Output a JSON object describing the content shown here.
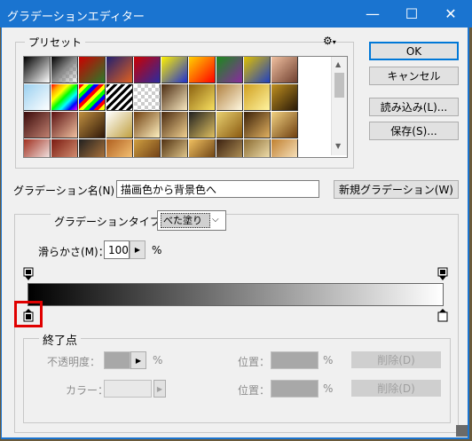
{
  "window": {
    "title": "グラデーションエディター",
    "minimize_glyph": "—",
    "maximize_glyph": "☐",
    "close_glyph": "✕"
  },
  "preset": {
    "label": "プリセット",
    "gear_glyph": "⚙"
  },
  "buttons": {
    "ok": "OK",
    "cancel": "キャンセル",
    "load": "読み込み(L)...",
    "save": "保存(S)..."
  },
  "name_row": {
    "label": "グラデーション名(N)：",
    "value": "描画色から背景色へ",
    "new_button": "新規グラデーション(W)"
  },
  "type_row": {
    "label": "グラデーションタイプ(T)：",
    "value": "べた塗り",
    "smoothness_label": "滑らかさ(M)：",
    "smoothness_value": "100",
    "percent": "%"
  },
  "stops": {
    "label": "終了点",
    "opacity_label": "不透明度：",
    "opacity_percent": "%",
    "location_label": "位置：",
    "location_percent": "%",
    "delete_label": "削除(D)",
    "color_label": "カラー：",
    "location2_label": "位置：",
    "location2_percent": "%",
    "delete2_label": "削除(D)"
  },
  "colors": {
    "titlebar": "#1a74d0",
    "highlight": "#e00000"
  }
}
